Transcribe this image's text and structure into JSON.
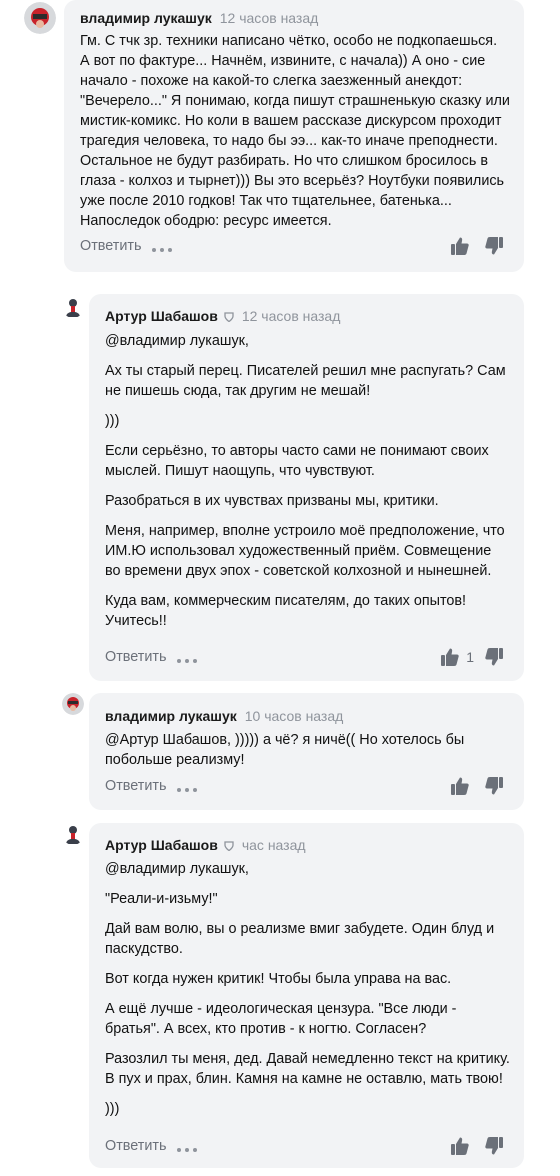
{
  "comments": [
    {
      "author": "владимир лукашук",
      "time": "12 часов назад",
      "paragraphs": [
        "Гм. С тчк зр. техники написано чётко, особо не подкопаешься. А вот по фактуре... Начнём, извините, с начала)) А оно - сие начало - похоже на какой-то слегка заезженный анекдот: \"Вечерело...\" Я понимаю, когда пишут страшненькую сказку или мистик-комикс. Но коли в вашем рассказе дискурсом проходит трагедия человека, то надо бы ээ... как-то иначе преподнести. Остальное не будут разбирать. Но что слишком бросилось в глаза - колхоз и тырнет))) Вы это всерьёз? Ноутбуки появились уже после 2010 годков! Так что тщательнее, батенька... Напоследок ободрю: ресурс имеется."
      ],
      "reply": "Ответить",
      "likes": ""
    },
    {
      "author": "Артур Шабашов",
      "time": "12 часов назад",
      "mention": "@владимир лукашук,",
      "paragraphs": [
        "Ах ты старый перец. Писателей решил мне распугать? Сам не пишешь сюда, так другим не мешай!",
        ")))",
        "Если серьёзно, то авторы часто сами не понимают своих мыслей. Пишут наощупь, что чувствуют.",
        "Разобраться в их чувствах призваны мы, критики.",
        "Меня, например, вполне устроило моё предположение, что ИМ.Ю использовал художественный приём. Совмещение во времени двух эпох - советской колхозной и нынешней.",
        "Куда вам, коммерческим писателям, до таких опытов! Учитесь!!"
      ],
      "reply": "Ответить",
      "likes": "1"
    },
    {
      "author": "владимир лукашук",
      "time": "10 часов назад",
      "paragraphs": [
        "@Артур Шабашов, ))))) а чё? я ничё(( Но хотелось бы побольше реализму!"
      ],
      "reply": "Ответить",
      "likes": ""
    },
    {
      "author": "Артур Шабашов",
      "time": "час назад",
      "mention": "@владимир лукашук,",
      "paragraphs": [
        "\"Реали-и-изьму!\"",
        "Дай вам волю, вы о реализме вмиг забудете. Один блуд и паскудство.",
        "Вот когда нужен критик! Чтобы была управа на вас.",
        "А ещё лучше - идеологическая цензура. \"Все люди - братья\". А всех, кто против - к ногтю. Согласен?",
        "Разозлил ты меня, дед. Давай немедленно текст на критику. В пух и прах, блин. Камня на камне не оставлю, мать твою!",
        ")))"
      ],
      "reply": "Ответить",
      "likes": ""
    }
  ],
  "icons": {
    "like": "thumbs-up-icon",
    "dislike": "thumbs-down-icon",
    "more": "more-dots-icon",
    "verified": "verified-badge-icon"
  },
  "colors": {
    "card": "#f2f3f5",
    "muted": "#8f949c",
    "action": "#6b7079"
  }
}
